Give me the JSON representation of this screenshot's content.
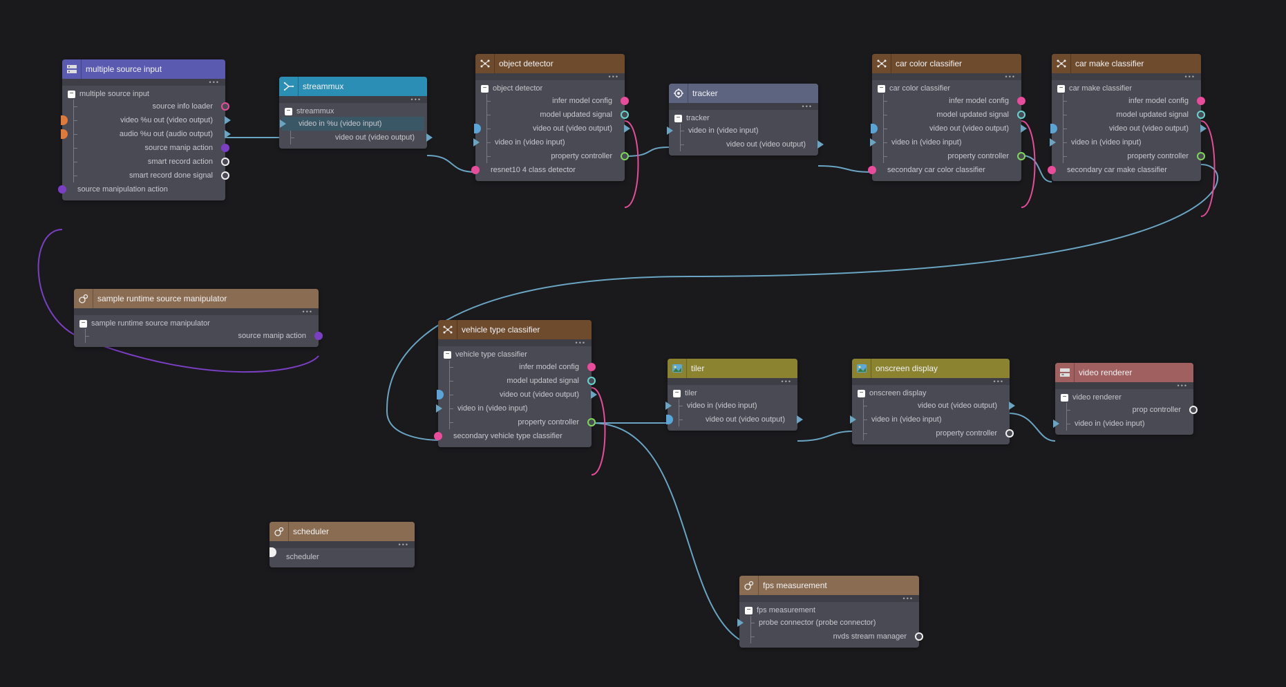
{
  "nodes": {
    "src": {
      "title": "multiple source input",
      "section": "multiple source input",
      "rows": [
        "source info loader",
        "video %u out (video output)",
        "audio %u out (audio output)",
        "source manip action",
        "smart record action",
        "smart record done signal",
        "source manipulation action"
      ]
    },
    "mux": {
      "title": "streammux",
      "section": "streammux",
      "rows": [
        "video in %u (video input)",
        "video out (video output)"
      ]
    },
    "det": {
      "title": "object detector",
      "section": "object detector",
      "rows": [
        "infer model config",
        "model updated signal",
        "video out (video output)",
        "video in (video input)",
        "property controller",
        "resnet10 4 class detector"
      ]
    },
    "trk": {
      "title": "tracker",
      "section": "tracker",
      "rows": [
        "video in (video input)",
        "video out (video output)"
      ]
    },
    "color": {
      "title": "car color classifier",
      "section": "car color classifier",
      "rows": [
        "infer model config",
        "model updated signal",
        "video out (video output)",
        "video in (video input)",
        "property controller",
        "secondary car color classifier"
      ]
    },
    "make": {
      "title": "car make classifier",
      "section": "car make classifier",
      "rows": [
        "infer model config",
        "model updated signal",
        "video out (video output)",
        "video in (video input)",
        "property controller",
        "secondary car make classifier"
      ]
    },
    "manip": {
      "title": "sample runtime source manipulator",
      "section": "sample runtime source manipulator",
      "rows": [
        "source manip action"
      ]
    },
    "vtype": {
      "title": "vehicle type classifier",
      "section": "vehicle type classifier",
      "rows": [
        "infer model config",
        "model updated signal",
        "video out (video output)",
        "video in (video input)",
        "property controller",
        "secondary vehicle type classifier"
      ]
    },
    "tiler": {
      "title": "tiler",
      "section": "tiler",
      "rows": [
        "video in (video input)",
        "video out (video output)"
      ]
    },
    "osd": {
      "title": "onscreen display",
      "section": "onscreen display",
      "rows": [
        "video out (video output)",
        "video in (video input)",
        "property controller"
      ]
    },
    "render": {
      "title": "video renderer",
      "section": "video renderer",
      "rows": [
        "prop controller",
        "video in (video input)"
      ]
    },
    "sched": {
      "title": "scheduler",
      "section": "scheduler",
      "rows": []
    },
    "fps": {
      "title": "fps measurement",
      "section": "fps measurement",
      "rows": [
        "probe connector (probe connector)",
        "nvds stream manager"
      ]
    }
  }
}
